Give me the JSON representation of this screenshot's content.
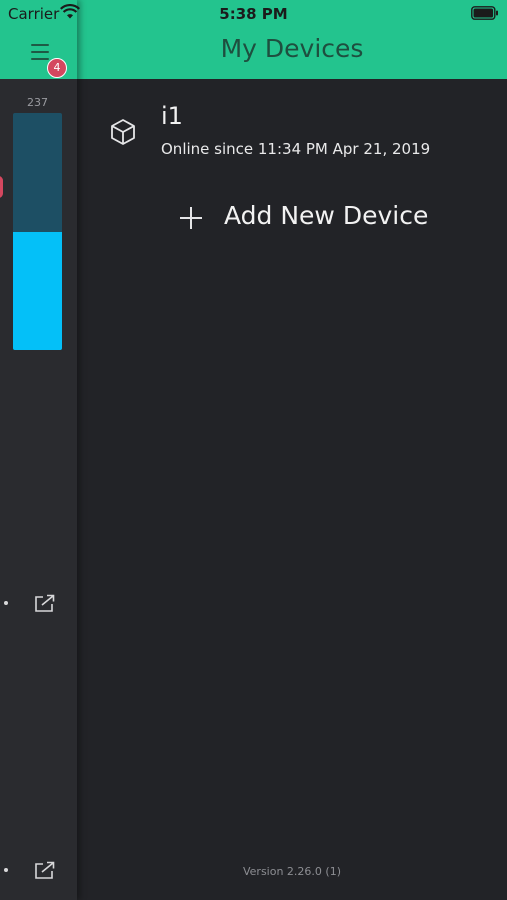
{
  "status_bar": {
    "carrier": "Carrier",
    "time": "5:38 PM"
  },
  "header": {
    "title": "My Devices",
    "accent_color": "#23c48e"
  },
  "sidebar": {
    "menu_badge": "4",
    "gauge": {
      "label": "237",
      "fill_fraction": 0.5,
      "color": "#04c0f8"
    }
  },
  "devices": [
    {
      "icon": "cube-icon",
      "name": "i1",
      "status": "Online since 11:34 PM Apr 21, 2019"
    }
  ],
  "add_device": {
    "icon": "plus-icon",
    "label": "Add New Device"
  },
  "footer": {
    "version": "Version 2.26.0 (1)"
  }
}
